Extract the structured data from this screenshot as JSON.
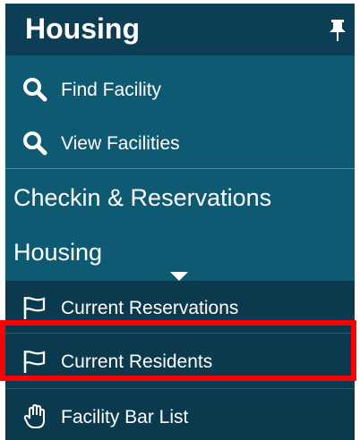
{
  "header": {
    "title": "Housing",
    "pin_icon": "pin-icon"
  },
  "menu": {
    "find_facility": {
      "label": "Find Facility",
      "icon": "search-icon"
    },
    "view_facilities": {
      "label": "View Facilities",
      "icon": "search-icon"
    },
    "checkin": {
      "label": "Checkin & Reservations"
    },
    "housing": {
      "label": "Housing",
      "icon": "caret-down-icon"
    },
    "current_reservations": {
      "label": "Current Reservations",
      "icon": "flag-icon"
    },
    "current_residents": {
      "label": "Current Residents",
      "icon": "flag-icon"
    },
    "facility_bar_list": {
      "label": "Facility Bar List",
      "icon": "hand-icon"
    }
  },
  "colors": {
    "header_bg": "#0c3f55",
    "panel_bg": "#0e5a73",
    "submenu_bg": "#0b3a4f",
    "highlight": "#ff0000",
    "text": "#ffffff"
  }
}
